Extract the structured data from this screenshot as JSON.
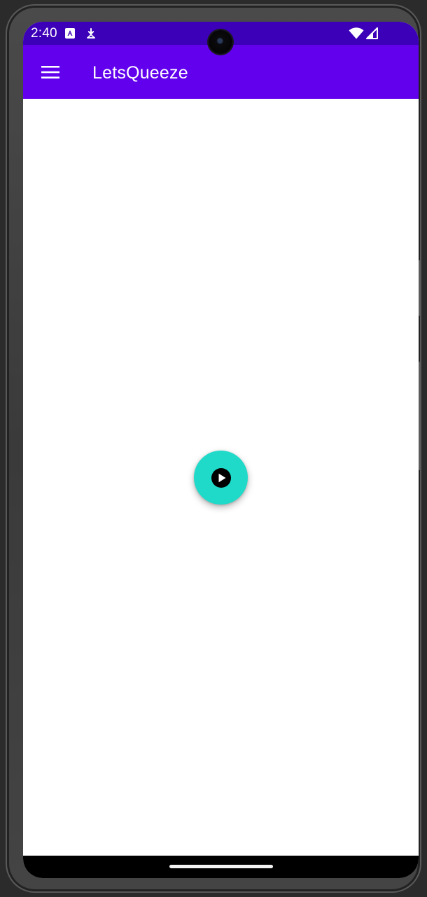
{
  "status_bar": {
    "time": "2:40",
    "icons": [
      "app-notification-icon",
      "download-notification-icon",
      "wifi-icon",
      "cellular-signal-icon"
    ]
  },
  "app_bar": {
    "title": "LetsQueeze",
    "menu_icon": "hamburger-menu-icon"
  },
  "fab": {
    "icon": "play-circle-icon"
  },
  "colors": {
    "status_bar": "#3b00b7",
    "app_bar": "#6200ee",
    "fab": "#1fdac8",
    "content_background": "#ffffff",
    "nav_bar": "#000000"
  }
}
